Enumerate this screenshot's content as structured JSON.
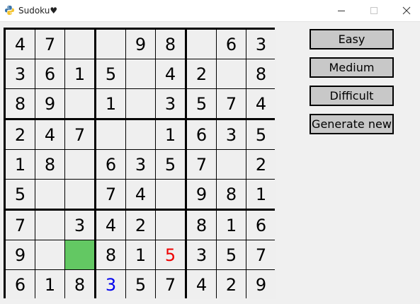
{
  "window": {
    "title": "Sudoku♥",
    "icon": "python-icon"
  },
  "buttons": {
    "easy": "Easy",
    "medium": "Medium",
    "difficult": "Difficult",
    "generate": "Generate new"
  },
  "board": {
    "selected_cell": [
      7,
      2
    ],
    "rows": [
      [
        "4",
        "7",
        "",
        "",
        "9",
        "8",
        "",
        "6",
        "3"
      ],
      [
        "3",
        "6",
        "1",
        "5",
        "",
        "4",
        "2",
        "",
        "8"
      ],
      [
        "8",
        "9",
        "",
        "1",
        "",
        "3",
        "5",
        "7",
        "4"
      ],
      [
        "2",
        "4",
        "7",
        "",
        "",
        "1",
        "6",
        "3",
        "5"
      ],
      [
        "1",
        "8",
        "",
        "6",
        "3",
        "5",
        "7",
        "",
        "2"
      ],
      [
        "5",
        "",
        "",
        "7",
        "4",
        "",
        "9",
        "8",
        "1"
      ],
      [
        "7",
        "",
        "3",
        "4",
        "2",
        "",
        "8",
        "1",
        "6"
      ],
      [
        "9",
        "",
        "",
        "8",
        "1",
        "5",
        "3",
        "5",
        "7"
      ],
      [
        "6",
        "1",
        "8",
        "3",
        "5",
        "7",
        "4",
        "2",
        "9"
      ]
    ],
    "colored_cells": [
      {
        "row": 7,
        "col": 5,
        "color": "red"
      },
      {
        "row": 8,
        "col": 3,
        "color": "blue"
      }
    ]
  },
  "colors": {
    "selected": "#63c863",
    "red_digit": "#ee0000",
    "blue_digit": "#0000ee",
    "button_bg": "#c8c8c8",
    "cell_bg": "#efefef"
  }
}
